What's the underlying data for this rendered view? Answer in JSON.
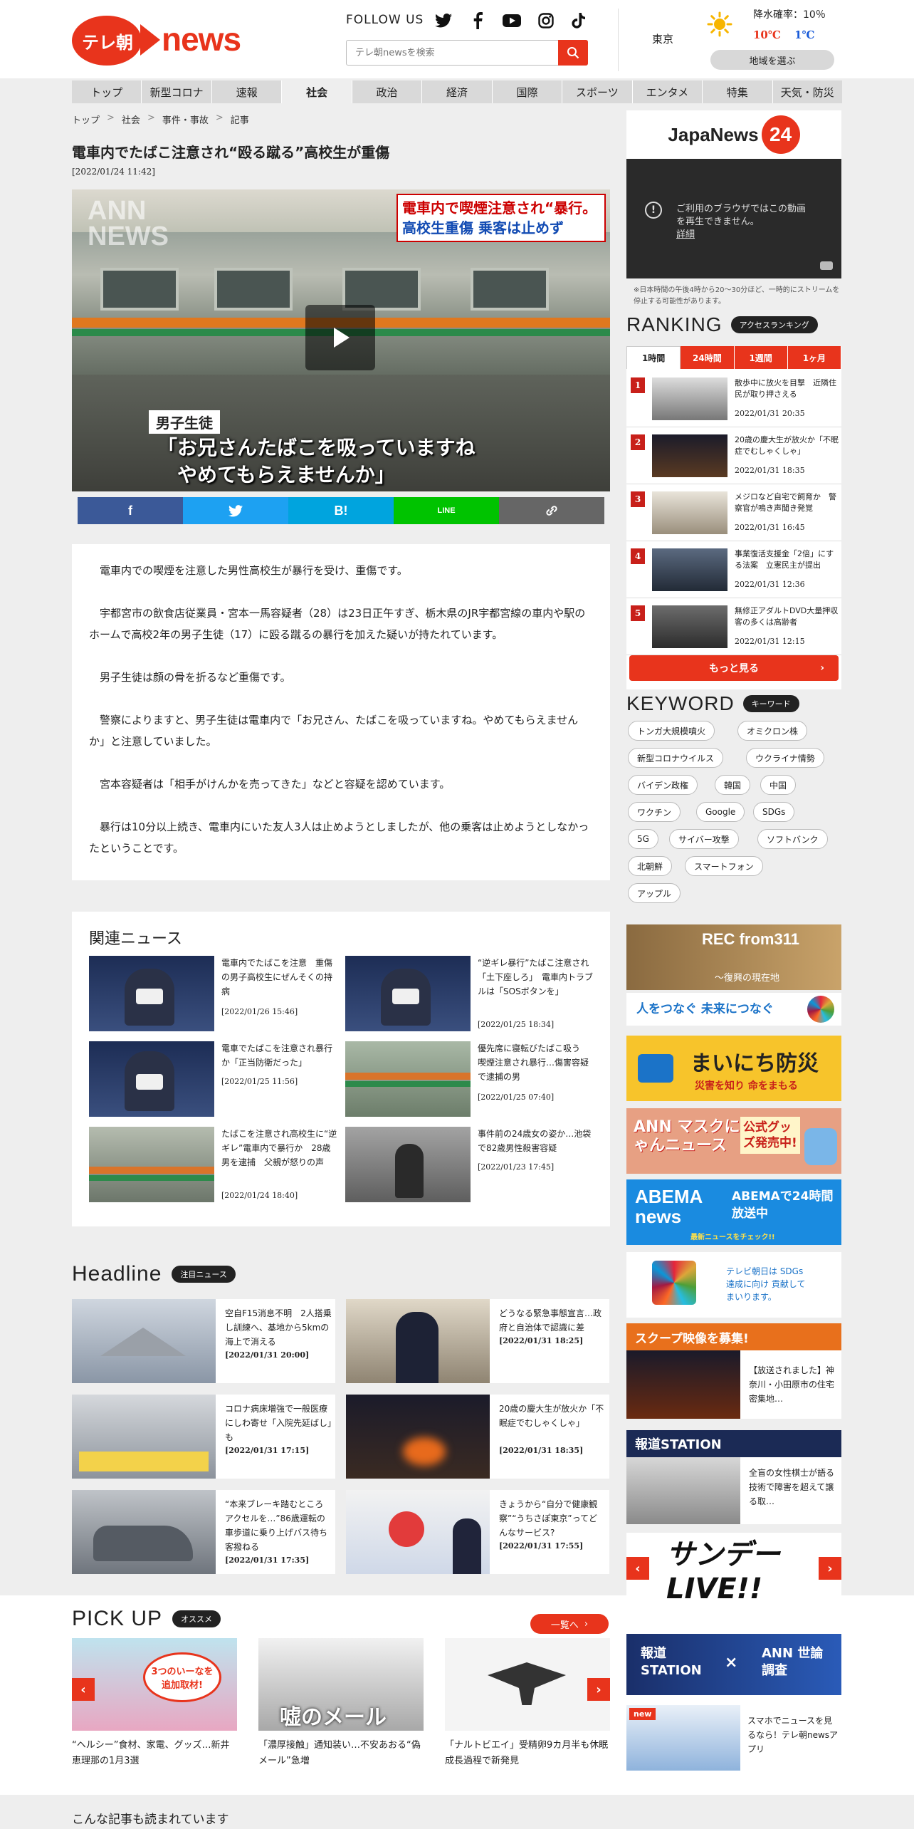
{
  "header": {
    "logo_tasa": "テレ朝",
    "logo_news": "news",
    "follow_us": "FOLLOW US",
    "search_placeholder": "テレ朝newsを検索",
    "weather": {
      "city": "東京",
      "rain_label": "降水確率：10％",
      "high": "10℃",
      "low": "1℃",
      "region_button": "地域を選ぶ",
      "high_color": "#e8341c",
      "low_color": "#1a5bd8"
    }
  },
  "nav": [
    "トップ",
    "新型コロナ",
    "速報",
    "社会",
    "政治",
    "経済",
    "国際",
    "スポーツ",
    "エンタメ",
    "特集",
    "天気・防災"
  ],
  "nav_active": "社会",
  "breadcrumb": [
    "トップ",
    "社会",
    "事件・事故",
    "記事"
  ],
  "article": {
    "title": "電車内でたばこ注意され“殴る蹴る”高校生が重傷",
    "date": "[2022/01/24 11:42]",
    "video": {
      "watermark": "ANN\nNEWS",
      "caption_line1": "電車内で喫煙注意され“暴行。",
      "caption_line2": "高校生重傷 乗客は止めず",
      "speaker": "男子生徒",
      "subtitle_line1": "「お兄さんたばこを吸っていますね",
      "subtitle_line2": "やめてもらえませんか」"
    },
    "share": [
      {
        "name": "facebook",
        "label": "f",
        "color": "#3b5998"
      },
      {
        "name": "twitter",
        "label": "🐦",
        "color": "#1da1f2"
      },
      {
        "name": "hatena",
        "label": "B!",
        "color": "#00a4de"
      },
      {
        "name": "line",
        "label": "LINE",
        "color": "#00c300"
      },
      {
        "name": "link",
        "label": "🔗",
        "color": "#666666"
      }
    ],
    "paragraphs": [
      "電車内での喫煙を注意した男性高校生が暴行を受け、重傷です。",
      "宇都宮市の飲食店従業員・宮本一馬容疑者（28）は23日正午すぎ、栃木県のJR宇都宮線の車内や駅のホームで高校2年の男子生徒（17）に殴る蹴るの暴行を加えた疑いが持たれています。",
      "男子生徒は顔の骨を折るなど重傷です。",
      "警察によりますと、男子生徒は電車内で「お兄さん、たばこを吸っていますね。やめてもらえませんか」と注意していました。",
      "宮本容疑者は「相手がけんかを売ってきた」などと容疑を認めています。",
      "暴行は10分以上続き、電車内にいた友人3人は止めようとしましたが、他の乗客は止めようとしなかったということです。"
    ]
  },
  "related": {
    "heading": "関連ニュース",
    "items": [
      {
        "title": "電車内でたばこを注意　重傷の男子高校生にぜんそくの持病",
        "date": "[2022/01/26 15:46]"
      },
      {
        "title": "“逆ギレ暴行”たばこ注意され「土下座しろ」　電車内トラブルは「SOSボタンを」",
        "date": "[2022/01/25 18:34]"
      },
      {
        "title": "電車でたばこを注意され暴行か「正当防衛だった」",
        "date": "[2022/01/25 11:56]"
      },
      {
        "title": "優先席に寝転びたばこ吸う　喫煙注意され暴行…傷害容疑で逮捕の男",
        "date": "[2022/01/25 07:40]"
      },
      {
        "title": "たばこを注意され高校生に“逆ギレ”電車内で暴行か　28歳男を逮捕　父親が怒りの声",
        "date": "[2022/01/24 18:40]"
      },
      {
        "title": "事件前の24歳女の姿か…池袋で82歳男性殺害容疑",
        "date": "[2022/01/23 17:45]"
      }
    ]
  },
  "headline": {
    "heading": "Headline",
    "badge": "注目ニュース",
    "items": [
      {
        "title": "空自F15消息不明　2人搭乗し訓練へ、基地から5kmの海上で消える",
        "date": "[2022/01/31 20:00]"
      },
      {
        "title": "どうなる緊急事態宣言…政府と自治体で認識に差",
        "date": "[2022/01/31 18:25]"
      },
      {
        "title": "コロナ病床増強で一般医療にしわ寄せ「入院先延ばし」も",
        "date": "[2022/01/31 17:15]"
      },
      {
        "title": "20歳の慶大生が放火か「不眠症でむしゃくしゃ」",
        "date": "[2022/01/31 18:35]"
      },
      {
        "title": "“本来ブレーキ踏むところアクセルを…”86歳運転の車歩道に乗り上げバス待ち客撥ねる",
        "date": "[2022/01/31 17:35]"
      },
      {
        "title": "きょうから“自分で健康観察”“うちさぽ東京”ってどんなサービス?",
        "date": "[2022/01/31 17:55]"
      }
    ]
  },
  "pickup": {
    "heading": "PICK UP",
    "badge": "オススメ",
    "more": "一覧へ",
    "items": [
      {
        "title": "“ヘルシー”食材、家電、グッズ…新井恵理那の1月3選",
        "thumb_text": "3つのいーなを追加取材!"
      },
      {
        "title": "「濃厚接触」通知装い…不安あおる“偽メール”急増",
        "thumb_text": "嘘のメール"
      },
      {
        "title": "「ナルトビエイ」受精卵9カ月半も休眠　成長過程で新発見",
        "thumb_text": ""
      }
    ]
  },
  "also_read": "こんな記事も読まれています",
  "sidebar": {
    "japanews": "JapaNews",
    "japanews_num": "24",
    "video_error": "ご利用のブラウザではこの動画\nを再生できません。",
    "video_detail": "詳細",
    "note": "※日本時間の午後4時から20～30分ほど、一時的にストリームを停止する可能性があります。",
    "ranking_heading": "RANKING",
    "ranking_badge": "アクセスランキング",
    "ranking_tabs": [
      "1時間",
      "24時間",
      "1週間",
      "1ヶ月"
    ],
    "ranking": [
      {
        "num": "1",
        "title": "散歩中に放火を目撃　近隣住民が取り押さえる",
        "date": "2022/01/31 20:35"
      },
      {
        "num": "2",
        "title": "20歳の慶大生が放火か「不眠症でむしゃくしゃ」",
        "date": "2022/01/31 18:35"
      },
      {
        "num": "3",
        "title": "メジロなど自宅で飼育か　警察官が鳴き声聞き発覚",
        "date": "2022/01/31 16:45"
      },
      {
        "num": "4",
        "title": "事業復活支援金「2倍」にする法案　立憲民主が提出",
        "date": "2022/01/31 12:36"
      },
      {
        "num": "5",
        "title": "無修正アダルトDVD大量押収　客の多くは高齢者",
        "date": "2022/01/31 12:15"
      }
    ],
    "ranking_more": "もっと見る",
    "keyword_heading": "KEYWORD",
    "keyword_badge": "キーワード",
    "keywords": [
      "トンガ大規模噴火",
      "オミクロン株",
      "新型コロナウイルス",
      "ウクライナ情勢",
      "バイデン政権",
      "韓国",
      "中国",
      "ワクチン",
      "Google",
      "SDGs",
      "5G",
      "サイバー攻撃",
      "ソフトバンク",
      "北朝鮮",
      "スマートフォン",
      "アップル"
    ],
    "banners": {
      "rec311": "REC from311",
      "rec311_sub": "～復興の現在地",
      "sdgs_tagline": "人をつなぐ 未来につなぐ",
      "bousai": "まいにち防災",
      "bousai_sub": "災害を知り 命をまもる",
      "mask": "ANN マスクにゃんニュース",
      "mask_sub": "公式グッズ発売中!",
      "abema": "ABEMA news",
      "abema_sub": "ABEMAで24時間放送中",
      "abema_sub2": "最新ニュースをチェック!!",
      "sdgs2": "テレビ朝日は SDGs達成に向け 貢献してまいります。",
      "scoop": "スクープ映像を募集!",
      "scoop_text": "【放送されました】神奈川・小田原市の住宅密集地…",
      "hodo": "報道STATION",
      "hodo_text": "全盲の女性棋士が語る　技術で障害を超えて譲る取…",
      "sunday": "サンデーLIVE!!",
      "survey_a": "報道 STATION",
      "survey_b": "ANN 世論調査",
      "app_new": "new",
      "app_text": "スマホでニュースを見るなら！テレ朝newsアプリ"
    }
  }
}
